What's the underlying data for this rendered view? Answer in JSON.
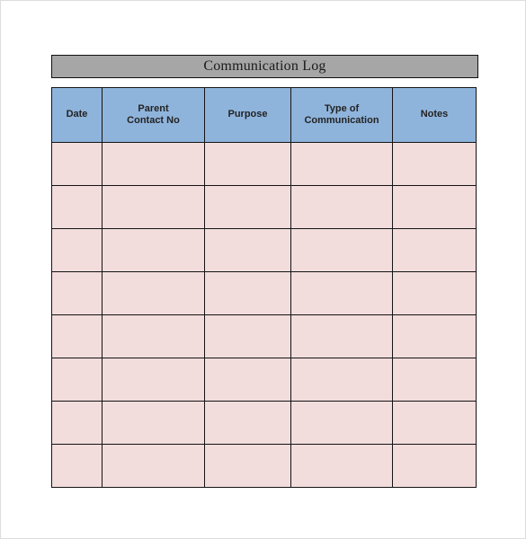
{
  "document": {
    "title": "Communication Log",
    "background_color": "#ffffff",
    "page_border_color": "#dddddd"
  },
  "title_bar": {
    "label": "Communication Log",
    "background_color": "#a6a6a6",
    "border_color": "#111111",
    "text_color": "#1a1a1a"
  },
  "table": {
    "header_background_color": "#8fb4dc",
    "body_background_color": "#f2dcdc",
    "border_color": "#141414",
    "columns": [
      {
        "key": "date",
        "lines": [
          "Date"
        ]
      },
      {
        "key": "parent",
        "lines": [
          "Parent",
          "Contact No"
        ]
      },
      {
        "key": "purpose",
        "lines": [
          "Purpose"
        ]
      },
      {
        "key": "type",
        "lines": [
          "Type of",
          "Communication"
        ]
      },
      {
        "key": "notes",
        "lines": [
          "Notes"
        ]
      }
    ],
    "row_count": 8,
    "rows": [
      {
        "date": "",
        "parent": "",
        "purpose": "",
        "type": "",
        "notes": ""
      },
      {
        "date": "",
        "parent": "",
        "purpose": "",
        "type": "",
        "notes": ""
      },
      {
        "date": "",
        "parent": "",
        "purpose": "",
        "type": "",
        "notes": ""
      },
      {
        "date": "",
        "parent": "",
        "purpose": "",
        "type": "",
        "notes": ""
      },
      {
        "date": "",
        "parent": "",
        "purpose": "",
        "type": "",
        "notes": ""
      },
      {
        "date": "",
        "parent": "",
        "purpose": "",
        "type": "",
        "notes": ""
      },
      {
        "date": "",
        "parent": "",
        "purpose": "",
        "type": "",
        "notes": ""
      },
      {
        "date": "",
        "parent": "",
        "purpose": "",
        "type": "",
        "notes": ""
      }
    ]
  }
}
